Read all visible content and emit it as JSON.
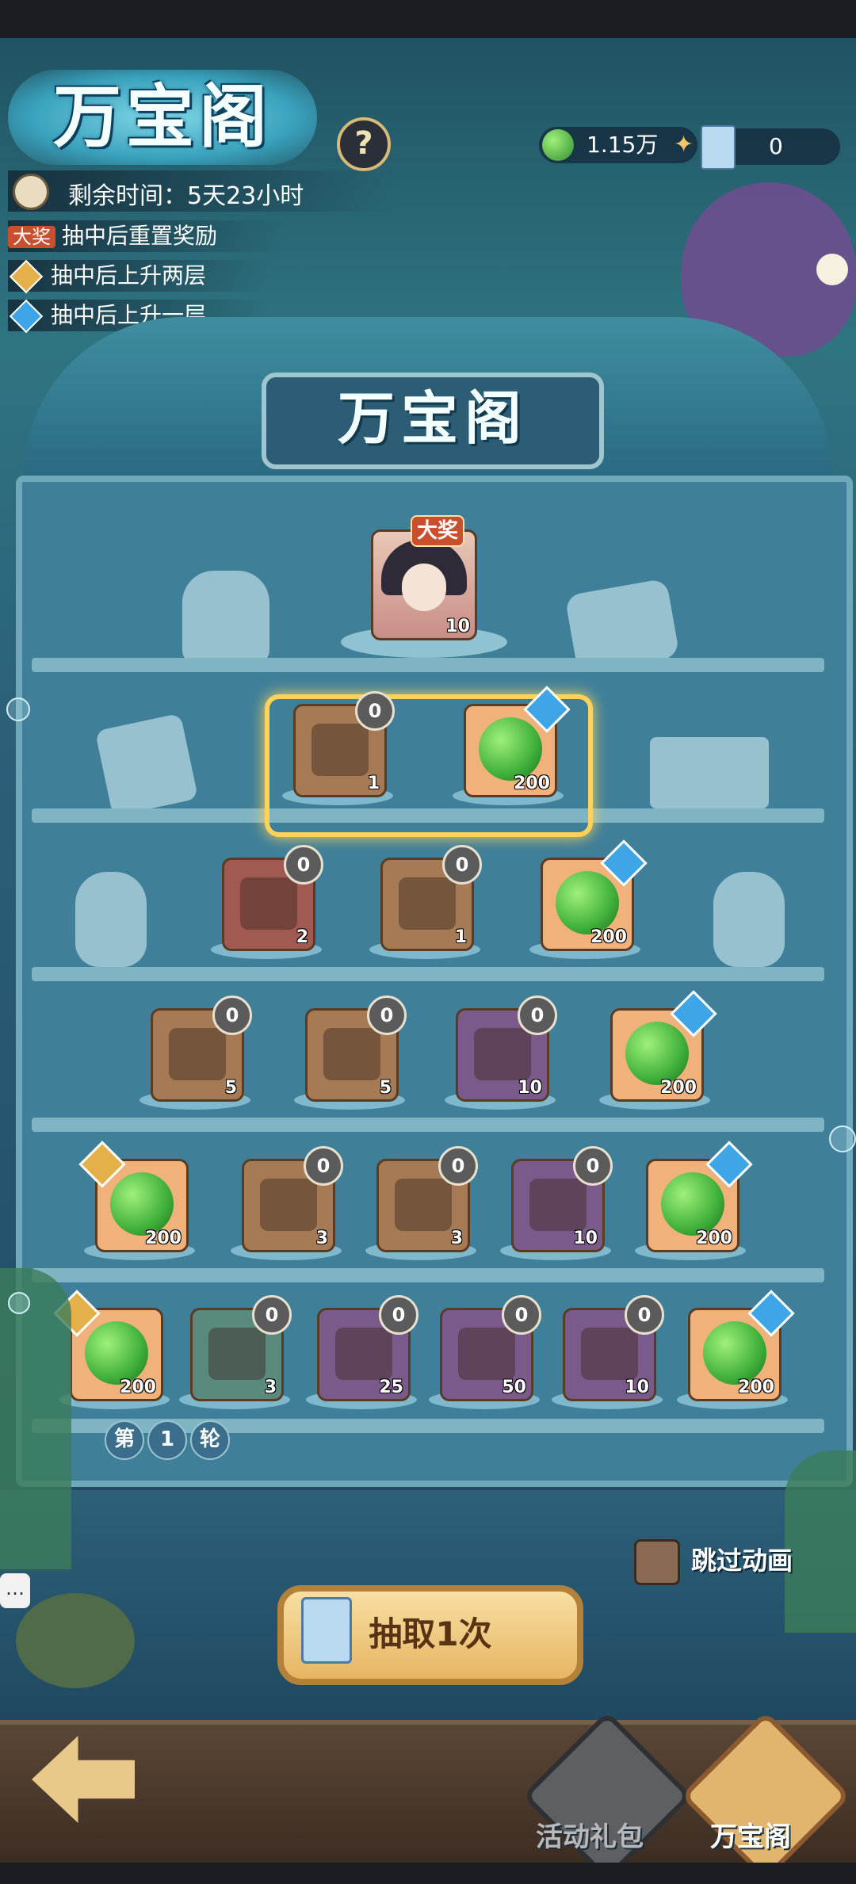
{
  "title": "万宝阁",
  "help_symbol": "?",
  "currency": {
    "jade_amount": "1.15万",
    "ticket_amount": "0"
  },
  "timer": {
    "label": "剩余时间：",
    "value": "5天23小时"
  },
  "rules": [
    {
      "tag": "大奖",
      "text": "抽中后重置奖励"
    },
    {
      "text": "抽中后上升两层"
    },
    {
      "text": "抽中后上升一层"
    }
  ],
  "sign_text": "万宝阁",
  "grand_prize": {
    "tag": "大奖",
    "count": "10"
  },
  "rows": [
    [
      {
        "count": "1",
        "badge": "0",
        "color": "brown",
        "kind": "mystery-chest"
      },
      {
        "count": "200",
        "color": "orange",
        "kind": "jade",
        "arrow": "blue"
      }
    ],
    [
      {
        "count": "2",
        "badge": "0",
        "color": "red",
        "kind": "swirl-orb"
      },
      {
        "count": "1",
        "badge": "0",
        "color": "brown",
        "kind": "gold-chest"
      },
      {
        "count": "200",
        "color": "orange",
        "kind": "jade",
        "arrow": "blue"
      }
    ],
    [
      {
        "count": "5",
        "badge": "0",
        "color": "brown",
        "kind": "scroll-tablet"
      },
      {
        "count": "5",
        "badge": "0",
        "color": "brown",
        "kind": "rune-stone"
      },
      {
        "count": "10",
        "badge": "0",
        "color": "purple",
        "kind": "crystal-ball"
      },
      {
        "count": "200",
        "color": "orange",
        "kind": "jade",
        "arrow": "blue"
      }
    ],
    [
      {
        "count": "200",
        "color": "orange",
        "kind": "jade",
        "arrow": "gold"
      },
      {
        "count": "3",
        "badge": "0",
        "color": "brown",
        "kind": "leather-scroll"
      },
      {
        "count": "3",
        "badge": "0",
        "color": "brown",
        "kind": "key"
      },
      {
        "count": "10",
        "badge": "0",
        "color": "purple",
        "kind": "yin-yang-disc"
      },
      {
        "count": "200",
        "color": "orange",
        "kind": "jade",
        "arrow": "blue"
      }
    ],
    [
      {
        "count": "200",
        "color": "orange",
        "kind": "jade",
        "arrow": "gold"
      },
      {
        "count": "3",
        "badge": "0",
        "color": "teal",
        "kind": "egg"
      },
      {
        "count": "25",
        "badge": "0",
        "color": "purple",
        "kind": "gem-chest"
      },
      {
        "count": "50",
        "badge": "0",
        "color": "purple",
        "kind": "sprout-orb"
      },
      {
        "count": "10",
        "badge": "0",
        "color": "purple",
        "kind": "flame-chest"
      },
      {
        "count": "200",
        "color": "orange",
        "kind": "jade",
        "arrow": "blue"
      }
    ]
  ],
  "round": {
    "prefix": "第",
    "number": "1",
    "suffix": "轮"
  },
  "skip_animation": "跳过动画",
  "draw_button": "抽取1次",
  "nav": {
    "gift": "活动礼包",
    "treasure": "万宝阁"
  },
  "colors": {
    "orange": "#f0b27a",
    "brown": "#a57a55",
    "purple": "#7a5a8a",
    "red": "#a15a52",
    "teal": "#5a8a7e",
    "highlight": "#ffd35a"
  }
}
